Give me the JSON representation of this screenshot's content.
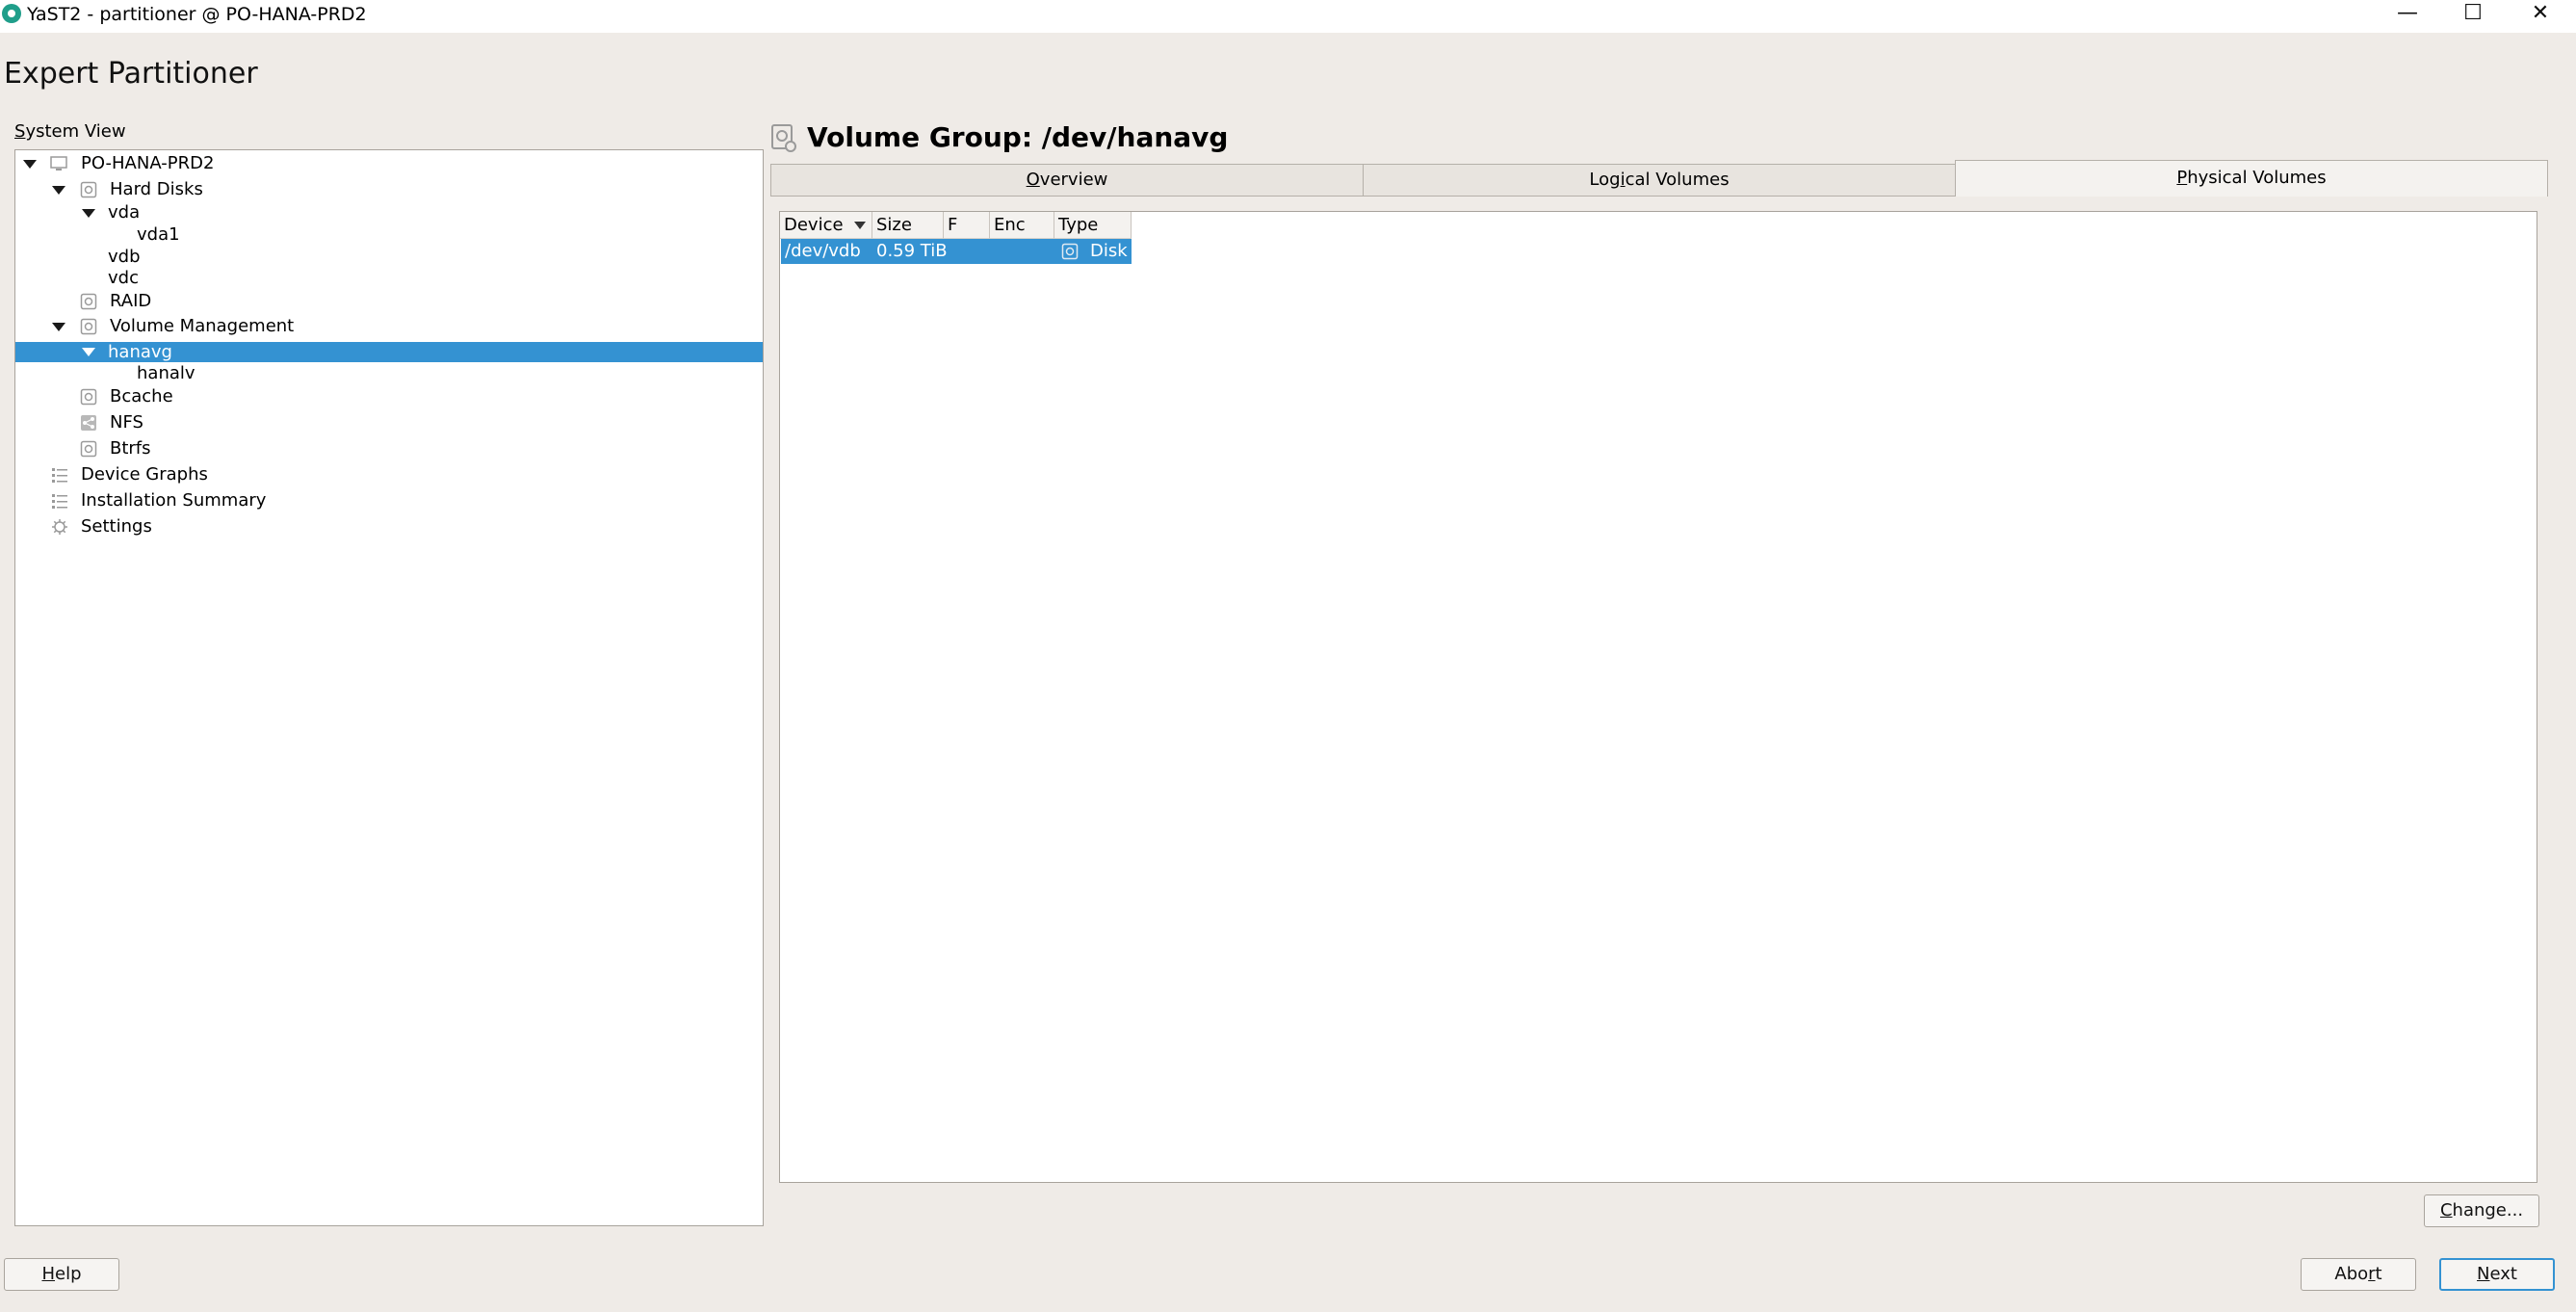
{
  "window": {
    "title": "YaST2 - partitioner @ PO-HANA-PRD2",
    "minimize_glyph": "—",
    "maximize_glyph": "☐",
    "close_glyph": "✕"
  },
  "page_title": "Expert Partitioner",
  "system_view": {
    "label_first": "S",
    "label_rest": "ystem View",
    "tree": [
      {
        "label": "PO-HANA-PRD2",
        "icon": "computer-icon",
        "expanded": true,
        "level": 0
      },
      {
        "label": "Hard Disks",
        "icon": "disk-icon",
        "expanded": true,
        "level": 1
      },
      {
        "label": "vda",
        "expanded": true,
        "level": 2
      },
      {
        "label": "vda1",
        "level": 3
      },
      {
        "label": "vdb",
        "level": 2
      },
      {
        "label": "vdc",
        "level": 2
      },
      {
        "label": "RAID",
        "icon": "raid-icon",
        "level": 1
      },
      {
        "label": "Volume Management",
        "icon": "volume-management-icon",
        "expanded": true,
        "level": 1
      },
      {
        "label": "hanavg",
        "expanded": true,
        "selected": true,
        "level": 2
      },
      {
        "label": "hanalv",
        "level": 3
      },
      {
        "label": "Bcache",
        "icon": "bcache-icon",
        "level": 1
      },
      {
        "label": "NFS",
        "icon": "nfs-icon",
        "level": 1
      },
      {
        "label": "Btrfs",
        "icon": "btrfs-icon",
        "level": 1
      },
      {
        "label": "Device Graphs",
        "icon": "device-graphs-icon",
        "level": 0
      },
      {
        "label": "Installation Summary",
        "icon": "installation-summary-icon",
        "level": 0
      },
      {
        "label": "Settings",
        "icon": "settings-icon",
        "level": 0
      }
    ]
  },
  "volume_group": {
    "title": "Volume Group: /dev/hanavg",
    "tabs": [
      {
        "first": "O",
        "rest": "verview"
      },
      {
        "pre": "Log",
        "u": "i",
        "post": "cal Volumes"
      },
      {
        "first": "P",
        "rest": "hysical Volumes",
        "active": true
      }
    ],
    "table": {
      "columns": [
        "Device",
        "Size",
        "F",
        "Enc",
        "Type"
      ],
      "rows": [
        {
          "device": "/dev/vdb",
          "size": "0.59 TiB",
          "f": "",
          "enc": "",
          "type": "Disk",
          "selected": true
        }
      ]
    }
  },
  "buttons": {
    "change": {
      "first": "C",
      "rest": "hange..."
    },
    "help": {
      "first": "H",
      "rest": "elp"
    },
    "abort": {
      "pre": "Abo",
      "u": "r",
      "post": "t"
    },
    "next": {
      "first": "N",
      "rest": "ext"
    }
  },
  "colors": {
    "selection": "#3492d2",
    "background": "#efebe7",
    "app_icon": "#1f9e8a"
  }
}
